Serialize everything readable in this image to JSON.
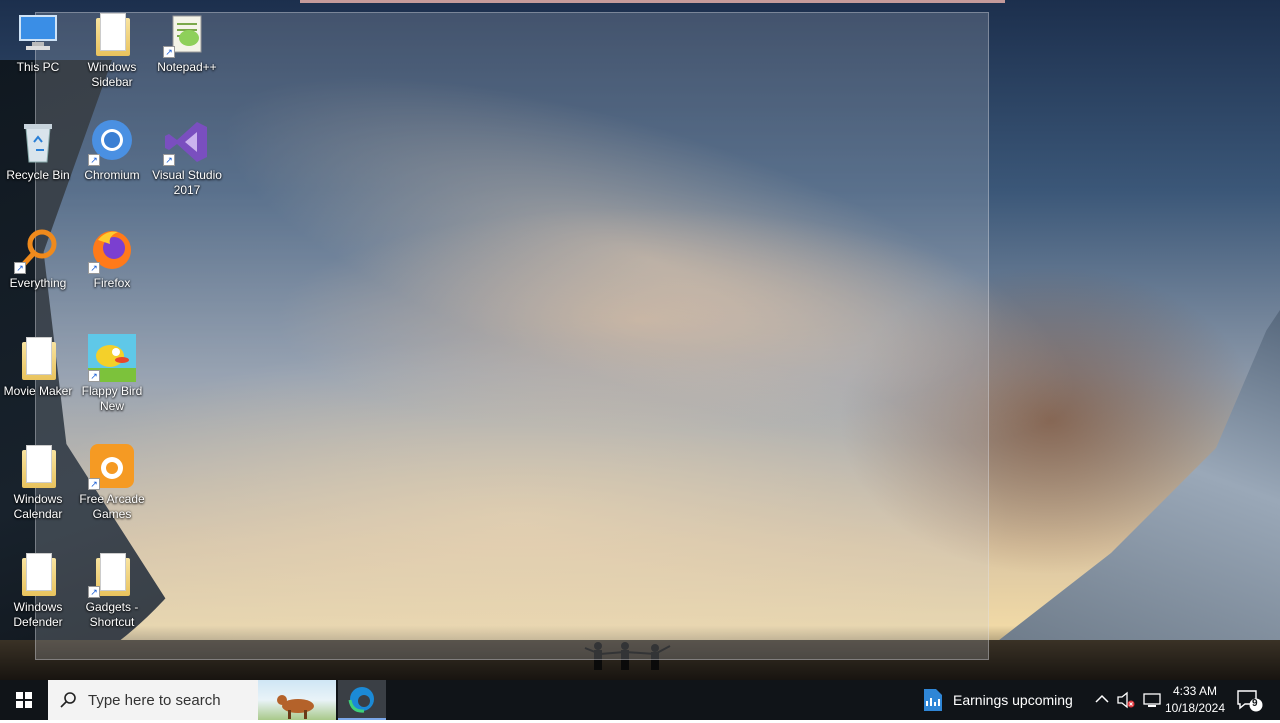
{
  "desktop": {
    "icons": [
      {
        "label": "This PC"
      },
      {
        "label": "Windows Sidebar"
      },
      {
        "label": "Notepad++"
      },
      {
        "label": "Recycle Bin"
      },
      {
        "label": "Chromium"
      },
      {
        "label": "Visual Studio 2017"
      },
      {
        "label": "Everything"
      },
      {
        "label": "Firefox"
      },
      {
        "label": "Movie Maker"
      },
      {
        "label": "Flappy Bird New"
      },
      {
        "label": "Windows Calendar"
      },
      {
        "label": "Free Arcade Games"
      },
      {
        "label": "Windows Defender"
      },
      {
        "label": "Gadgets - Shortcut"
      }
    ]
  },
  "taskbar": {
    "search_placeholder": "Type here to search",
    "widget_label": "Earnings upcoming",
    "time": "4:33 AM",
    "date": "10/18/2024",
    "notification_count": "9"
  },
  "colors": {
    "taskbar": "#101418",
    "search_box": "#f3f3f3",
    "accent": "#7aa7e8"
  }
}
